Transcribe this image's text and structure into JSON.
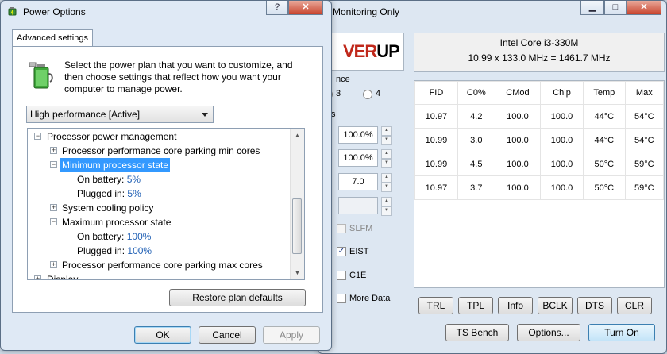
{
  "throttlestop": {
    "title": "Monitoring Only",
    "logo": {
      "part1": "VER",
      "part2": "UP"
    },
    "cpu_name": "Intel Core i3-330M",
    "cpu_freq": "10.99 x 133.0 MHz = 1461.7 MHz",
    "section_label": "nce",
    "radio_3": "3",
    "radio_4": "4",
    "section_label2": "s",
    "spin_values": [
      "100.0%",
      "100.0%",
      "7.0"
    ],
    "checks": [
      {
        "label": "SLFM",
        "checked": false
      },
      {
        "label": "EIST",
        "checked": true
      },
      {
        "label": "C1E",
        "checked": false
      },
      {
        "label": "More Data",
        "checked": false
      }
    ],
    "table": {
      "headers": [
        "FID",
        "C0%",
        "CMod",
        "Chip",
        "Temp",
        "Max"
      ],
      "rows": [
        [
          "10.97",
          "4.2",
          "100.0",
          "100.0",
          "44°C",
          "54°C"
        ],
        [
          "10.99",
          "3.0",
          "100.0",
          "100.0",
          "44°C",
          "54°C"
        ],
        [
          "10.99",
          "4.5",
          "100.0",
          "100.0",
          "50°C",
          "59°C"
        ],
        [
          "10.97",
          "3.7",
          "100.0",
          "100.0",
          "50°C",
          "59°C"
        ]
      ]
    },
    "buttons_row1": [
      "TRL",
      "TPL",
      "Info",
      "BCLK",
      "DTS",
      "CLR"
    ],
    "ts_bench": "TS Bench",
    "options": "Options...",
    "turn_on": "Turn On"
  },
  "power_options": {
    "title": "Power Options",
    "tab": "Advanced settings",
    "description": "Select the power plan that you want to customize, and then choose settings that reflect how you want your computer to manage power.",
    "plan_selected": "High performance [Active]",
    "tree": {
      "processor_power_management": "Processor power management",
      "parking_min": "Processor performance core parking min cores",
      "min_state": "Minimum processor state",
      "min_battery_label": "On battery:",
      "min_battery_value": "5%",
      "min_plugged_label": "Plugged in:",
      "min_plugged_value": "5%",
      "cooling": "System cooling policy",
      "max_state": "Maximum processor state",
      "max_battery_label": "On battery:",
      "max_battery_value": "100%",
      "max_plugged_label": "Plugged in:",
      "max_plugged_value": "100%",
      "parking_max": "Processor performance core parking max cores",
      "display": "Display"
    },
    "restore": "Restore plan defaults",
    "ok": "OK",
    "cancel": "Cancel",
    "apply": "Apply",
    "help_glyph": "?",
    "close_glyph": "✕"
  },
  "icons": [
    "power-options-icon",
    "battery-plug-icon",
    "minimize-icon",
    "maximize-icon",
    "close-icon",
    "help-icon"
  ]
}
